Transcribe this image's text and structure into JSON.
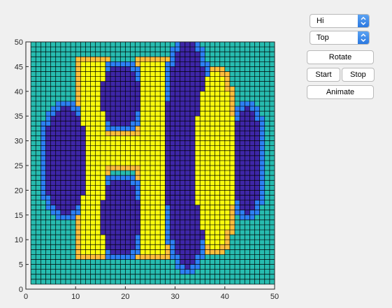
{
  "controls": {
    "mode_popup": {
      "selected": "Hi"
    },
    "view_popup": {
      "selected": "Top"
    },
    "rotate_label": "Rotate",
    "start_label": "Start",
    "stop_label": "Stop",
    "animate_label": "Animate"
  },
  "chart_data": {
    "type": "heatmap",
    "title": "",
    "xlabel": "",
    "ylabel": "",
    "xlim": [
      0,
      50
    ],
    "ylim": [
      0,
      50
    ],
    "xticks": [
      0,
      10,
      20,
      30,
      40,
      50
    ],
    "yticks": [
      0,
      5,
      10,
      15,
      20,
      25,
      30,
      35,
      40,
      45,
      50
    ],
    "grid": {
      "x": [
        1,
        50
      ],
      "y": [
        1,
        50
      ],
      "cells": 49,
      "lines": "black"
    },
    "colormap": "parula",
    "background_value": 0,
    "value_range": [
      -1,
      1
    ],
    "shapes": [
      {
        "kind": "letter",
        "letter": "H",
        "value": 1,
        "x_range": [
          11,
          28
        ],
        "y_range": [
          7.5,
          45.5
        ]
      },
      {
        "kind": "ellipse",
        "value": -1,
        "center": [
          19,
          39
        ],
        "radius": [
          4,
          6
        ]
      },
      {
        "kind": "ellipse",
        "value": -1,
        "center": [
          19,
          14.5
        ],
        "radius": [
          4,
          8
        ]
      },
      {
        "kind": "ellipse",
        "value": -1,
        "center": [
          8,
          26
        ],
        "radius": [
          4.5,
          11
        ]
      },
      {
        "kind": "ellipse",
        "value": -1,
        "center": [
          32.5,
          27.5
        ],
        "radius": [
          4.5,
          23
        ]
      },
      {
        "kind": "ellipse",
        "value": 1,
        "center": [
          38,
          26
        ],
        "radius": [
          4,
          18
        ]
      },
      {
        "kind": "ellipse",
        "value": -1,
        "center": [
          44.5,
          26
        ],
        "radius": [
          3,
          11
        ]
      }
    ],
    "colors": {
      "high": "#f9fb0e",
      "low": "#3e26a8",
      "background": "#27bcb0",
      "halo_high": "#ffbe3c",
      "halo_low": "#2d80f5"
    }
  }
}
